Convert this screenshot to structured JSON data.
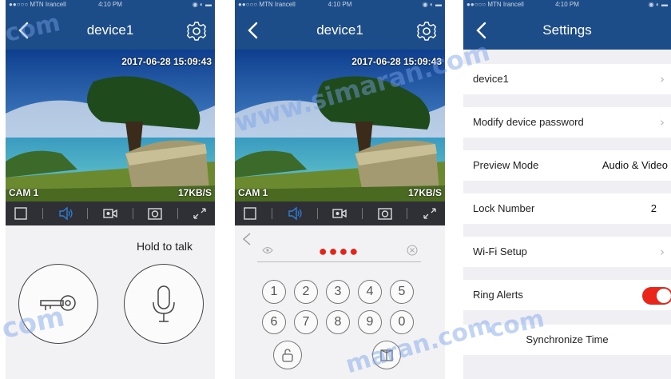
{
  "status": {
    "carrier": "●●○○○ MTN Irancell",
    "time": "4:10 PM",
    "icons": "◉ ◐ ▬"
  },
  "screen1": {
    "title": "device1",
    "timestamp": "2017-06-28  15:09:43",
    "cam_label": "CAM 1",
    "bitrate": "17KB/S",
    "hold_to_talk": "Hold to talk"
  },
  "screen2": {
    "title": "device1",
    "timestamp": "2017-06-28  15:09:43",
    "cam_label": "CAM 1",
    "bitrate": "17KB/S",
    "password_dots": "●●●●",
    "keys": [
      "1",
      "2",
      "3",
      "4",
      "5",
      "6",
      "7",
      "8",
      "9",
      "0"
    ]
  },
  "screen3": {
    "title": "Settings",
    "rows": [
      {
        "label": "device1",
        "value": "",
        "chevron": "›"
      },
      {
        "label": "Modify device password",
        "value": "",
        "chevron": "›"
      },
      {
        "label": "Preview Mode",
        "value": "Audio & Video",
        "chevron": ""
      },
      {
        "label": "Lock Number",
        "value": "2",
        "chevron": ""
      },
      {
        "label": "Wi-Fi Setup",
        "value": "",
        "chevron": "›"
      },
      {
        "label": "Ring Alerts",
        "value": "",
        "chevron": "",
        "toggle": true
      },
      {
        "label": "Synchronize Time",
        "value": "",
        "chevron": ""
      }
    ]
  },
  "watermarks": [
    "com",
    "com",
    "www.simaran.com",
    "com",
    "maran.com"
  ],
  "colors": {
    "navbar": "#1d4d88",
    "accent": "#2f7fd8",
    "toggle_on": "#e8261a",
    "password": "#e0251b"
  }
}
